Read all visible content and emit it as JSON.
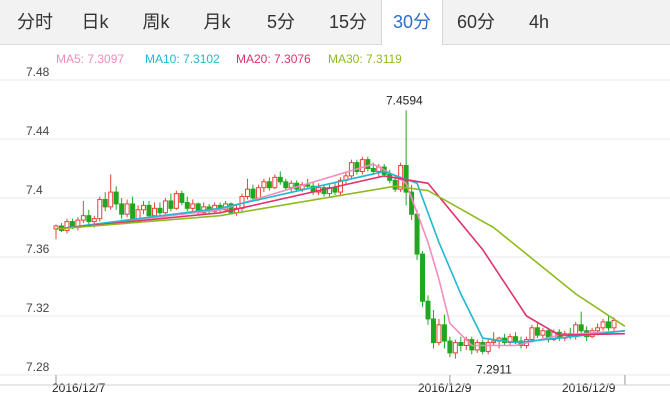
{
  "tabs": [
    {
      "label": "分时",
      "active": false
    },
    {
      "label": "日k",
      "active": false
    },
    {
      "label": "周k",
      "active": false
    },
    {
      "label": "月k",
      "active": false
    },
    {
      "label": "5分",
      "active": false
    },
    {
      "label": "15分",
      "active": false
    },
    {
      "label": "30分",
      "active": true
    },
    {
      "label": "60分",
      "active": false
    },
    {
      "label": "4h",
      "active": false
    }
  ],
  "legend": {
    "ma5": "MA5: 7.3097",
    "ma10": "MA10: 7.3102",
    "ma20": "MA20: 7.3076",
    "ma30": "MA30: 7.3119"
  },
  "colors": {
    "up": "#e8413b",
    "down": "#1fa81f",
    "ma5": "#f48cbf",
    "ma10": "#22b8cf",
    "ma20": "#e0326e",
    "ma30": "#8dbb1e",
    "active_tab": "#2c6ecb"
  },
  "chart_data": {
    "type": "candlestick",
    "ylim": [
      7.28,
      7.48
    ],
    "y_ticks": [
      "7.48",
      "7.44",
      "7.4",
      "7.36",
      "7.32",
      "7.28"
    ],
    "x_ticks": [
      "2016/12/7",
      "2016/12/9",
      "2016/12/9"
    ],
    "annotations": {
      "high_label": "7.4594",
      "low_label": "7.2911"
    },
    "candles": [
      [
        7.379,
        7.382,
        7.372,
        7.381
      ],
      [
        7.381,
        7.383,
        7.377,
        7.378
      ],
      [
        7.378,
        7.386,
        7.376,
        7.384
      ],
      [
        7.384,
        7.386,
        7.379,
        7.38
      ],
      [
        7.38,
        7.387,
        7.378,
        7.385
      ],
      [
        7.385,
        7.398,
        7.383,
        7.388
      ],
      [
        7.388,
        7.392,
        7.382,
        7.384
      ],
      [
        7.384,
        7.388,
        7.38,
        7.386
      ],
      [
        7.386,
        7.401,
        7.384,
        7.399
      ],
      [
        7.399,
        7.404,
        7.391,
        7.394
      ],
      [
        7.394,
        7.416,
        7.392,
        7.404
      ],
      [
        7.404,
        7.408,
        7.392,
        7.396
      ],
      [
        7.396,
        7.4,
        7.386,
        7.389
      ],
      [
        7.389,
        7.399,
        7.387,
        7.396
      ],
      [
        7.396,
        7.401,
        7.384,
        7.386
      ],
      [
        7.386,
        7.395,
        7.384,
        7.392
      ],
      [
        7.392,
        7.398,
        7.389,
        7.395
      ],
      [
        7.395,
        7.398,
        7.386,
        7.388
      ],
      [
        7.388,
        7.397,
        7.387,
        7.393
      ],
      [
        7.393,
        7.397,
        7.388,
        7.39
      ],
      [
        7.39,
        7.4,
        7.389,
        7.398
      ],
      [
        7.398,
        7.403,
        7.391,
        7.393
      ],
      [
        7.393,
        7.405,
        7.392,
        7.403
      ],
      [
        7.403,
        7.405,
        7.395,
        7.397
      ],
      [
        7.397,
        7.401,
        7.391,
        7.393
      ],
      [
        7.393,
        7.399,
        7.391,
        7.396
      ],
      [
        7.396,
        7.397,
        7.389,
        7.39
      ],
      [
        7.39,
        7.397,
        7.389,
        7.394
      ],
      [
        7.394,
        7.396,
        7.389,
        7.391
      ],
      [
        7.391,
        7.397,
        7.389,
        7.395
      ],
      [
        7.395,
        7.397,
        7.39,
        7.392
      ],
      [
        7.392,
        7.398,
        7.391,
        7.396
      ],
      [
        7.396,
        7.397,
        7.389,
        7.39
      ],
      [
        7.39,
        7.396,
        7.388,
        7.393
      ],
      [
        7.393,
        7.403,
        7.391,
        7.401
      ],
      [
        7.401,
        7.413,
        7.399,
        7.406
      ],
      [
        7.406,
        7.409,
        7.398,
        7.4
      ],
      [
        7.4,
        7.409,
        7.398,
        7.407
      ],
      [
        7.407,
        7.413,
        7.404,
        7.411
      ],
      [
        7.411,
        7.414,
        7.405,
        7.407
      ],
      [
        7.407,
        7.416,
        7.406,
        7.414
      ],
      [
        7.414,
        7.418,
        7.409,
        7.411
      ],
      [
        7.411,
        7.413,
        7.405,
        7.407
      ],
      [
        7.407,
        7.412,
        7.404,
        7.41
      ],
      [
        7.41,
        7.412,
        7.404,
        7.406
      ],
      [
        7.406,
        7.411,
        7.404,
        7.409
      ],
      [
        7.409,
        7.413,
        7.406,
        7.408
      ],
      [
        7.408,
        7.411,
        7.402,
        7.404
      ],
      [
        7.404,
        7.41,
        7.402,
        7.407
      ],
      [
        7.407,
        7.409,
        7.401,
        7.403
      ],
      [
        7.403,
        7.409,
        7.401,
        7.407
      ],
      [
        7.407,
        7.411,
        7.402,
        7.404
      ],
      [
        7.404,
        7.414,
        7.402,
        7.412
      ],
      [
        7.412,
        7.418,
        7.409,
        7.415
      ],
      [
        7.415,
        7.426,
        7.413,
        7.424
      ],
      [
        7.424,
        7.426,
        7.416,
        7.418
      ],
      [
        7.418,
        7.428,
        7.416,
        7.426
      ],
      [
        7.426,
        7.428,
        7.418,
        7.42
      ],
      [
        7.42,
        7.424,
        7.416,
        7.418
      ],
      [
        7.418,
        7.423,
        7.414,
        7.421
      ],
      [
        7.421,
        7.423,
        7.414,
        7.416
      ],
      [
        7.416,
        7.419,
        7.41,
        7.412
      ],
      [
        7.412,
        7.415,
        7.404,
        7.406
      ],
      [
        7.406,
        7.424,
        7.404,
        7.422
      ],
      [
        7.422,
        7.4594,
        7.395,
        7.404
      ],
      [
        7.404,
        7.409,
        7.385,
        7.389
      ],
      [
        7.389,
        7.392,
        7.358,
        7.362
      ],
      [
        7.362,
        7.364,
        7.326,
        7.33
      ],
      [
        7.33,
        7.334,
        7.314,
        7.318
      ],
      [
        7.318,
        7.324,
        7.298,
        7.302
      ],
      [
        7.302,
        7.318,
        7.3,
        7.314
      ],
      [
        7.314,
        7.321,
        7.298,
        7.303
      ],
      [
        7.303,
        7.306,
        7.292,
        7.295
      ],
      [
        7.295,
        7.304,
        7.2911,
        7.302
      ],
      [
        7.302,
        7.306,
        7.296,
        7.3
      ],
      [
        7.3,
        7.306,
        7.297,
        7.304
      ],
      [
        7.304,
        7.306,
        7.294,
        7.297
      ],
      [
        7.297,
        7.304,
        7.295,
        7.302
      ],
      [
        7.302,
        7.304,
        7.294,
        7.296
      ],
      [
        7.296,
        7.304,
        7.294,
        7.302
      ],
      [
        7.302,
        7.309,
        7.3,
        7.303
      ],
      [
        7.303,
        7.306,
        7.298,
        7.305
      ],
      [
        7.305,
        7.308,
        7.3,
        7.302
      ],
      [
        7.302,
        7.308,
        7.3,
        7.306
      ],
      [
        7.306,
        7.309,
        7.301,
        7.303
      ],
      [
        7.303,
        7.306,
        7.298,
        7.3
      ],
      [
        7.3,
        7.306,
        7.298,
        7.304
      ],
      [
        7.304,
        7.314,
        7.302,
        7.312
      ],
      [
        7.312,
        7.315,
        7.305,
        7.307
      ],
      [
        7.307,
        7.312,
        7.305,
        7.31
      ],
      [
        7.31,
        7.312,
        7.302,
        7.304
      ],
      [
        7.304,
        7.311,
        7.303,
        7.309
      ],
      [
        7.309,
        7.311,
        7.303,
        7.305
      ],
      [
        7.305,
        7.31,
        7.303,
        7.308
      ],
      [
        7.308,
        7.312,
        7.304,
        7.306
      ],
      [
        7.306,
        7.316,
        7.304,
        7.314
      ],
      [
        7.314,
        7.323,
        7.308,
        7.31
      ],
      [
        7.31,
        7.313,
        7.303,
        7.306
      ],
      [
        7.306,
        7.312,
        7.305,
        7.31
      ],
      [
        7.31,
        7.315,
        7.308,
        7.312
      ],
      [
        7.312,
        7.318,
        7.31,
        7.316
      ],
      [
        7.316,
        7.32,
        7.31,
        7.312
      ],
      [
        7.312,
        7.319,
        7.31,
        7.317
      ]
    ],
    "ma_series": [
      {
        "name": "MA5",
        "values": [
          [
            0,
            7.379
          ],
          [
            30,
            7.392
          ],
          [
            58,
            7.423
          ],
          [
            62,
            7.415
          ],
          [
            64,
            7.41
          ],
          [
            66,
            7.39
          ],
          [
            68,
            7.37
          ],
          [
            70,
            7.345
          ],
          [
            72,
            7.315
          ],
          [
            76,
            7.3
          ],
          [
            84,
            7.3
          ],
          [
            92,
            7.307
          ],
          [
            104,
            7.31
          ]
        ]
      },
      {
        "name": "MA10",
        "values": [
          [
            0,
            7.379
          ],
          [
            30,
            7.393
          ],
          [
            60,
            7.418
          ],
          [
            66,
            7.41
          ],
          [
            68,
            7.39
          ],
          [
            70,
            7.37
          ],
          [
            74,
            7.335
          ],
          [
            78,
            7.305
          ],
          [
            84,
            7.302
          ],
          [
            92,
            7.305
          ],
          [
            104,
            7.31
          ]
        ]
      },
      {
        "name": "MA20",
        "values": [
          [
            0,
            7.379
          ],
          [
            30,
            7.39
          ],
          [
            60,
            7.415
          ],
          [
            68,
            7.41
          ],
          [
            78,
            7.365
          ],
          [
            86,
            7.32
          ],
          [
            92,
            7.307
          ],
          [
            104,
            7.308
          ]
        ]
      },
      {
        "name": "MA30",
        "values": [
          [
            0,
            7.379
          ],
          [
            30,
            7.388
          ],
          [
            62,
            7.408
          ],
          [
            68,
            7.405
          ],
          [
            80,
            7.38
          ],
          [
            95,
            7.335
          ],
          [
            104,
            7.313
          ]
        ]
      }
    ]
  }
}
